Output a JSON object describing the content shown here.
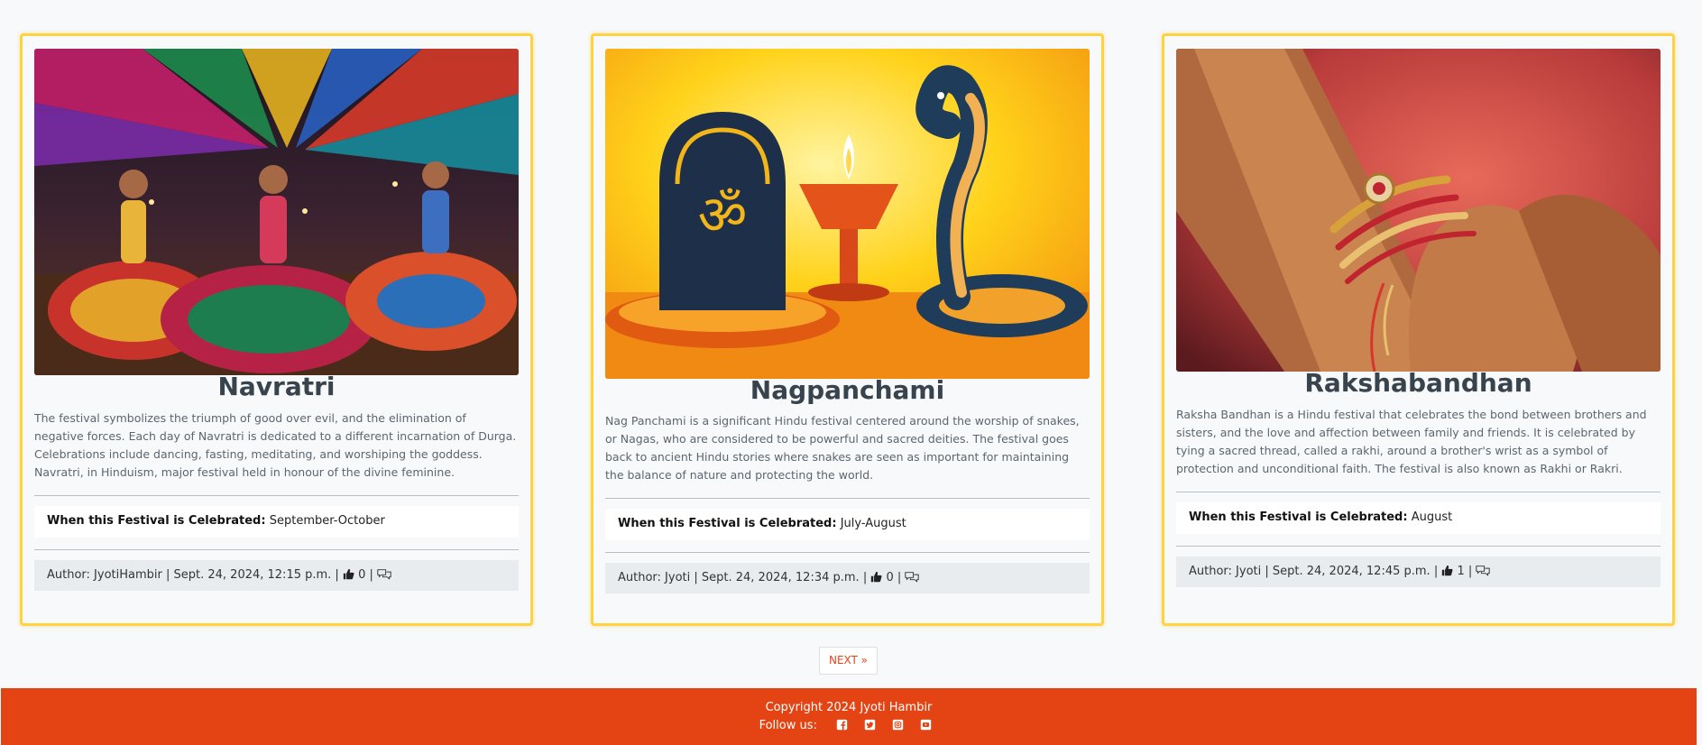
{
  "cards": [
    {
      "title": "Navratri",
      "image_alt": "Navratri dancers",
      "description": "The festival symbolizes the triumph of good over evil, and the elimination of negative forces. Each day of Navratri is dedicated to a different incarnation of Durga. Celebrations include dancing, fasting, meditating, and worshiping the goddess. Navratri, in Hinduism, major festival held in honour of the divine feminine.",
      "when_label": "When this Festival is Celebrated:",
      "when_value": "September-October",
      "meta_text": "Author: JyotiHambir | Sept. 24, 2024, 12:15 p.m. |",
      "likes": "0"
    },
    {
      "title": "Nagpanchami",
      "image_alt": "Nagpanchami snake and lamp",
      "description": "Nag Panchami is a significant Hindu festival centered around the worship of snakes, or Nagas, who are considered to be powerful and sacred deities. The festival goes back to ancient Hindu stories where snakes are seen as important for maintaining the balance of nature and protecting the world.",
      "when_label": "When this Festival is Celebrated:",
      "when_value": "July-August",
      "meta_text": "Author: Jyoti | Sept. 24, 2024, 12:34 p.m. |",
      "likes": "0"
    },
    {
      "title": "Rakshabandhan",
      "image_alt": "Rakhi tied on wrist",
      "description": "Raksha Bandhan is a Hindu festival that celebrates the bond between brothers and sisters, and the love and affection between family and friends. It is celebrated by tying a sacred thread, called a rakhi, around a brother's wrist as a symbol of protection and unconditional faith. The festival is also known as Rakhi or Rakri.",
      "when_label": "When this Festival is Celebrated:",
      "when_value": "August",
      "meta_text": "Author: Jyoti | Sept. 24, 2024, 12:45 p.m. |",
      "likes": "1"
    }
  ],
  "pagination": {
    "next_label": "NEXT »"
  },
  "footer": {
    "copyright": "Copyright 2024 Jyoti Hambir",
    "follow_label": "Follow us:",
    "social_icons": [
      "facebook-icon",
      "twitter-icon",
      "instagram-icon",
      "youtube-icon"
    ]
  },
  "colors": {
    "card_border": "#ffd23f",
    "footer_bg": "#e44413",
    "next_text": "#e8441a"
  }
}
